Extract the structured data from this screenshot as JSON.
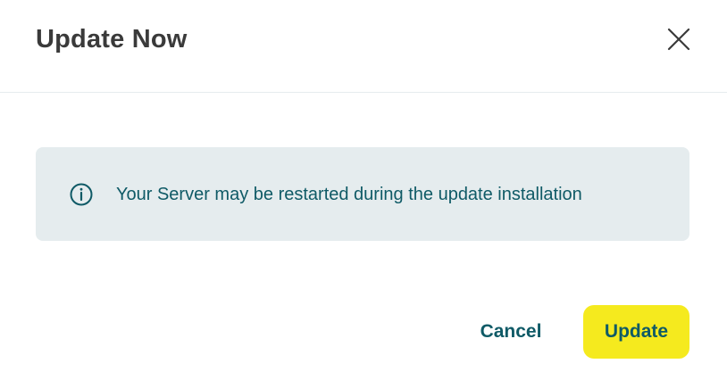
{
  "dialog": {
    "title": "Update Now",
    "close_icon": "close-icon",
    "notice": {
      "icon": "info-icon",
      "text": "Your Server may be restarted during the update installation"
    },
    "actions": {
      "cancel_label": "Cancel",
      "update_label": "Update"
    }
  },
  "colors": {
    "title": "#3a3a3a",
    "accent_teal": "#0f5a66",
    "notice_bg": "#e5ecee",
    "primary_button": "#f5ea1e"
  }
}
